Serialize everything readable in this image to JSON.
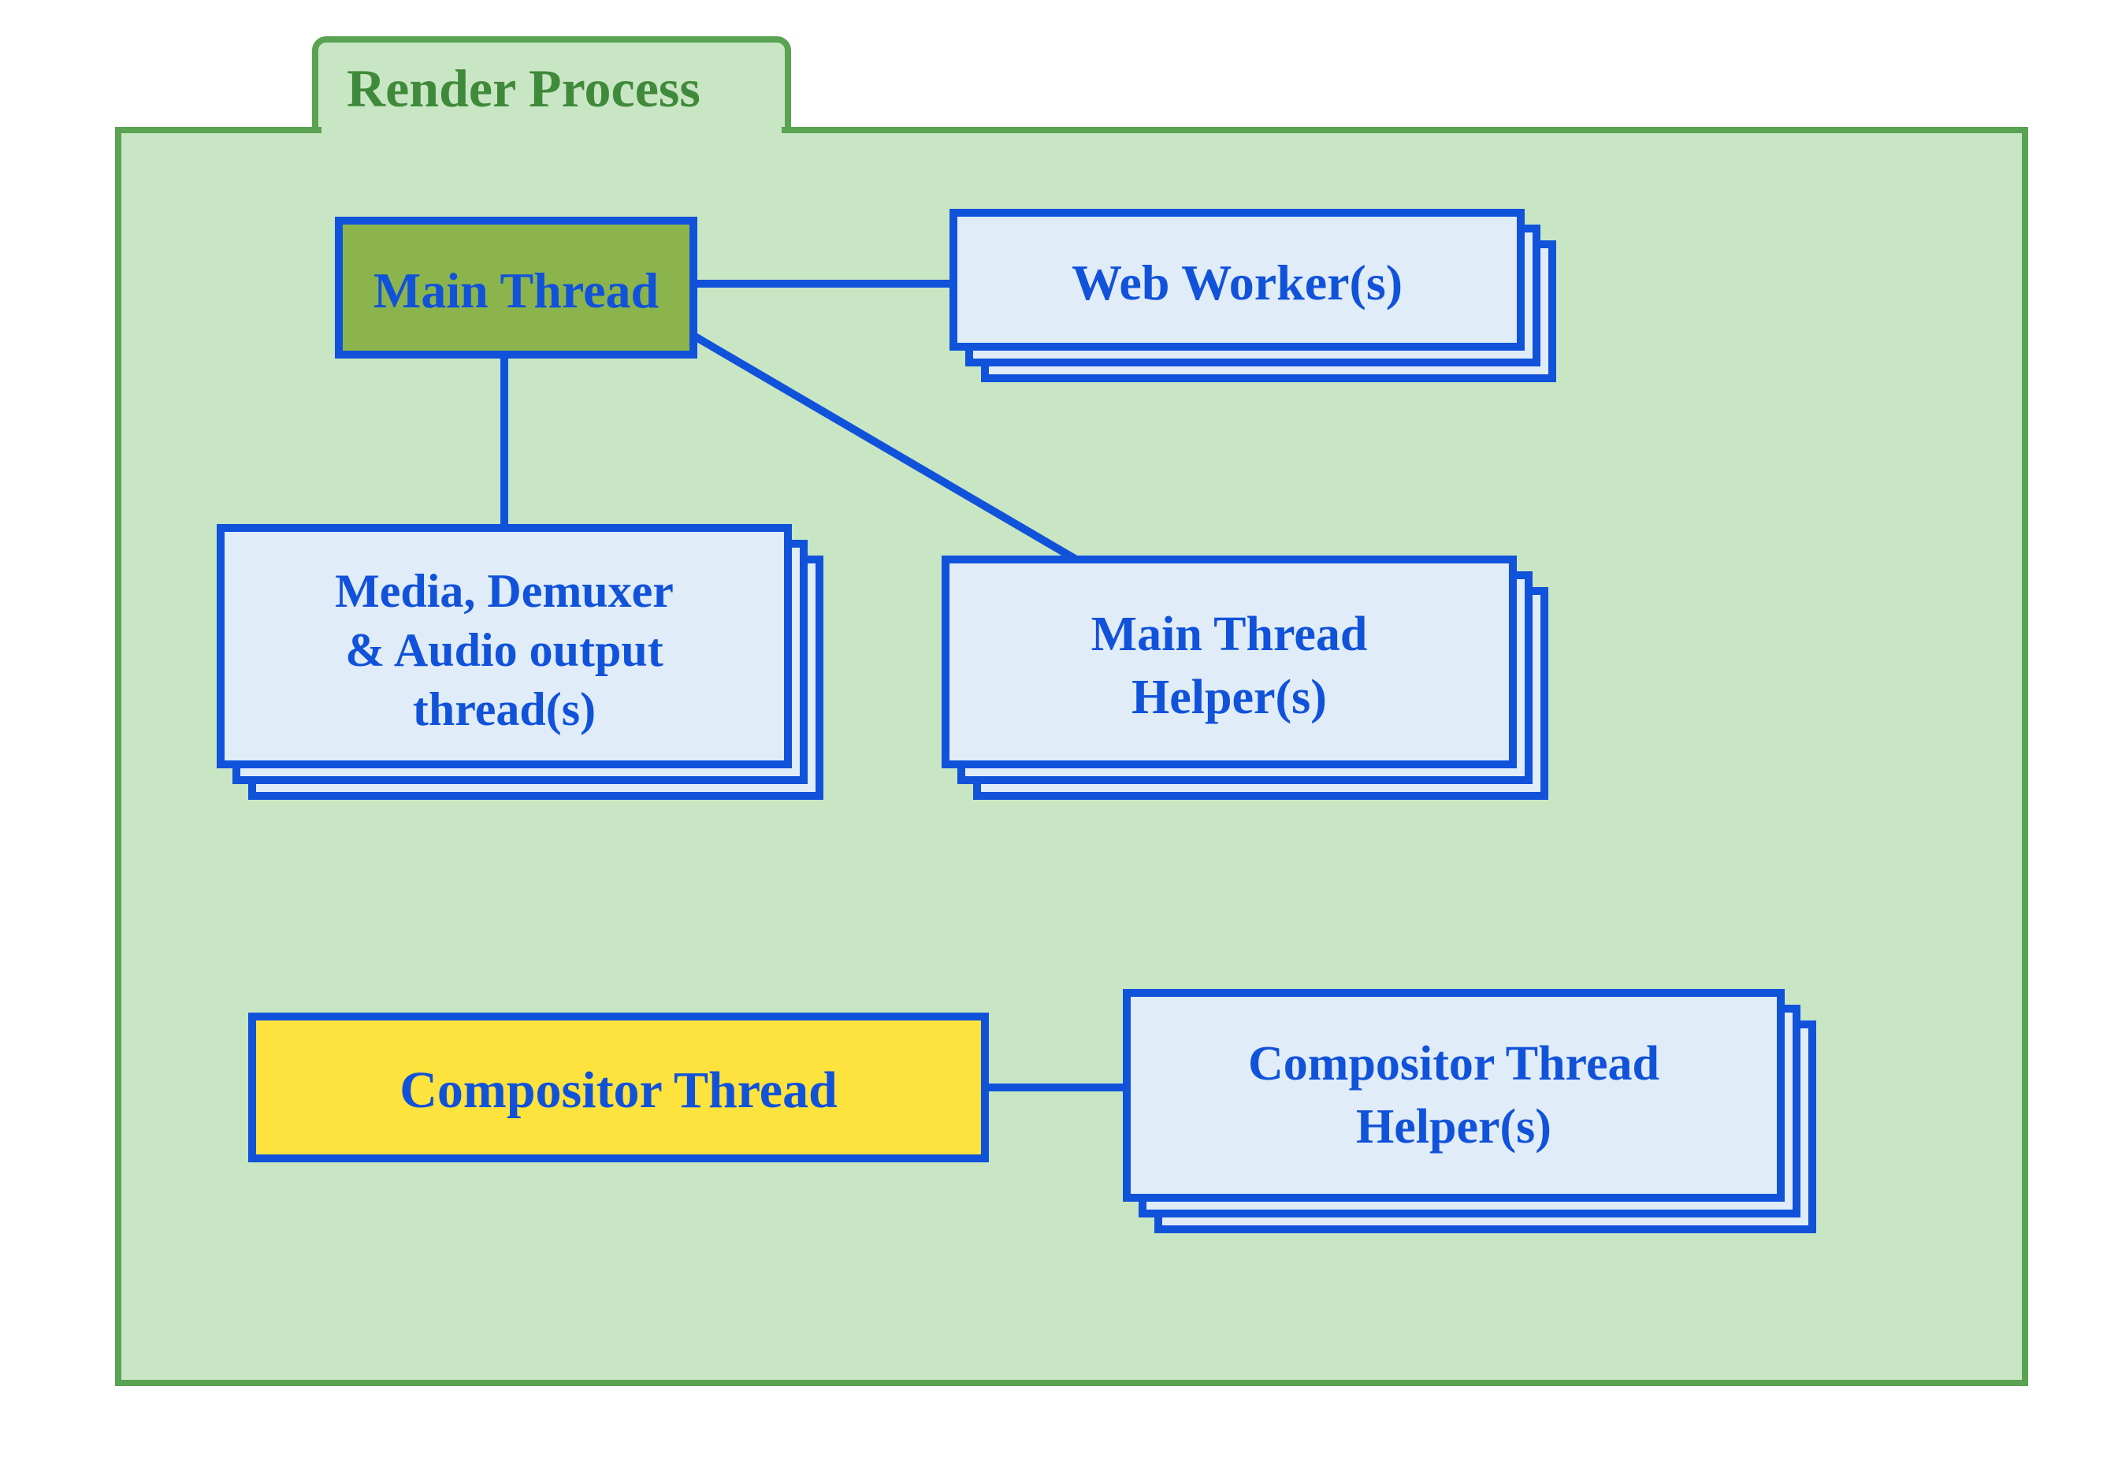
{
  "diagram": {
    "title": "Render Process",
    "nodes": {
      "main_thread": "Main Thread",
      "web_workers": "Web Worker(s)",
      "media_line1": "Media, Demuxer",
      "media_line2": "& Audio output",
      "media_line3": "thread(s)",
      "main_helper_line1": "Main Thread",
      "main_helper_line2": "Helper(s)",
      "compositor_thread": "Compositor Thread",
      "compositor_helper_line1": "Compositor Thread",
      "compositor_helper_line2": "Helper(s)"
    },
    "colors": {
      "container_fill": "#c8e6c4",
      "container_stroke": "#5aa352",
      "tab_label": "#3f8a3a",
      "node_stroke": "#1152da",
      "node_fill_default": "#e0ecf8",
      "node_fill_olive": "#8cb44c",
      "node_fill_yellow": "#fee23e",
      "text": "#1152da"
    },
    "edges": [
      [
        "main_thread",
        "web_workers"
      ],
      [
        "main_thread",
        "media"
      ],
      [
        "main_thread",
        "main_thread_helpers"
      ],
      [
        "compositor_thread",
        "compositor_thread_helpers"
      ]
    ]
  }
}
